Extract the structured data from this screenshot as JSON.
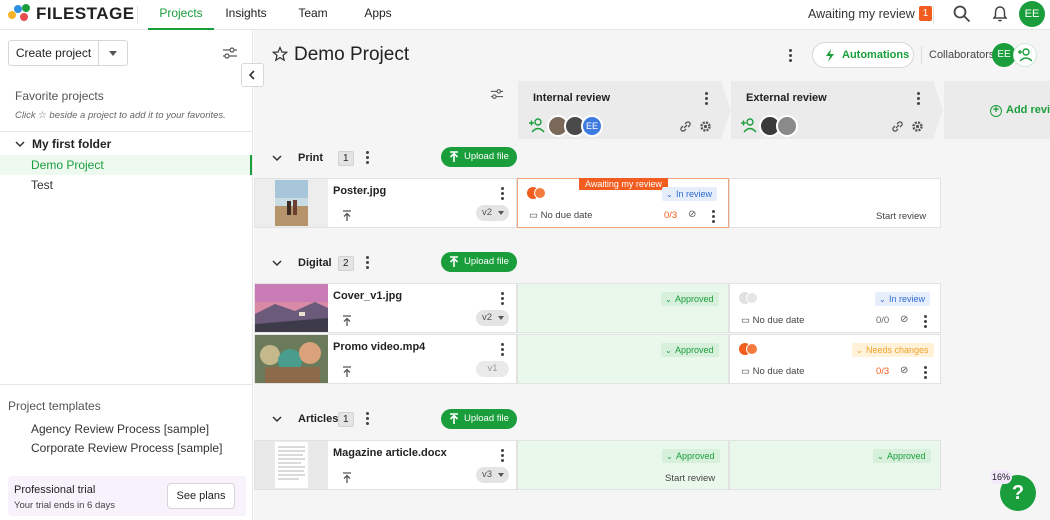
{
  "app": {
    "brand": "FILESTAGE",
    "nav_tabs": [
      "Projects",
      "Insights",
      "Team",
      "Apps"
    ],
    "awaiting_label": "Awaiting my review",
    "awaiting_count": "1",
    "user_initials": "EE"
  },
  "sidebar": {
    "create_label": "Create project",
    "favorites_title": "Favorite projects",
    "favorites_hint_pre": "Click",
    "favorites_hint_post": "beside a project to add it to your favorites.",
    "folder_name": "My first folder",
    "projects": [
      "Demo Project",
      "Test"
    ],
    "templates_title": "Project templates",
    "templates": [
      "Agency Review Process [sample]",
      "Corporate Review Process [sample]"
    ],
    "trial_title": "Professional trial",
    "trial_sub": "Your trial ends in 6 days",
    "see_plans": "See plans"
  },
  "project": {
    "title": "Demo Project",
    "automations_label": "Automations",
    "collaborators_label": "Collaborators",
    "collaborator_initials": "EE",
    "stages": [
      "Internal review",
      "External review"
    ],
    "stage_avatar_initials": "EE",
    "add_review": "Add review",
    "upload_label": "Upload file",
    "groups": [
      {
        "name": "Print",
        "count": "1"
      },
      {
        "name": "Digital",
        "count": "2"
      },
      {
        "name": "Articles",
        "count": "1"
      }
    ],
    "files": [
      {
        "name": "Poster.jpg",
        "version": "v2"
      },
      {
        "name": "Cover_v1.jpg",
        "version": "v2"
      },
      {
        "name": "Promo video.mp4",
        "version": "v1"
      },
      {
        "name": "Magazine article.docx",
        "version": "v3"
      }
    ],
    "cells": {
      "awaiting_tag": "Awaiting my review",
      "in_review": "In review",
      "approved": "Approved",
      "needs_changes": "Needs changes",
      "no_due": "No due date",
      "start_review": "Start review",
      "count_poster": "0/3",
      "count_cover": "0/0",
      "count_promo": "0/3"
    }
  },
  "widget": {
    "percent": "16%",
    "help": "?"
  },
  "colors": {
    "brand_green": "#1a9e3b",
    "orange": "#f25c1e",
    "blue": "#2f6bd2"
  }
}
